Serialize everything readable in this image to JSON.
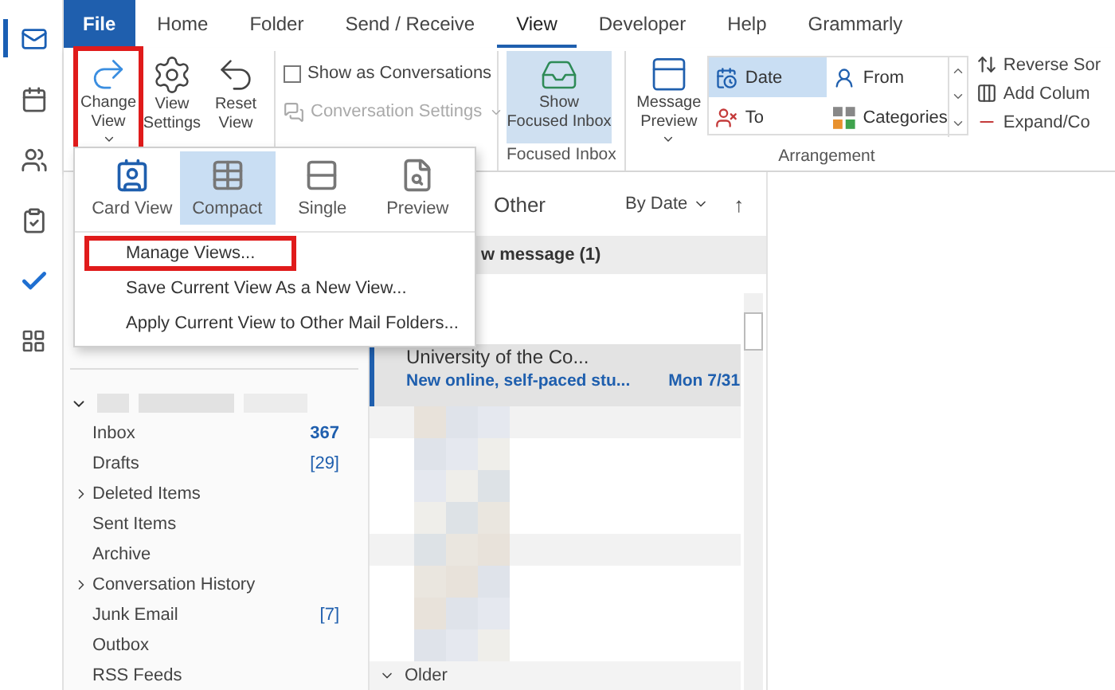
{
  "rail": [
    {
      "kind": "mail",
      "selected": true
    },
    {
      "kind": "calendar",
      "selected": false
    },
    {
      "kind": "people",
      "selected": false
    },
    {
      "kind": "tasks",
      "selected": false
    },
    {
      "kind": "todo",
      "selected": false
    },
    {
      "kind": "apps",
      "selected": false
    }
  ],
  "tabs": [
    {
      "label": "File",
      "kind": "file",
      "selected": false
    },
    {
      "label": "Home",
      "kind": "tab",
      "selected": false
    },
    {
      "label": "Folder",
      "kind": "tab",
      "selected": false
    },
    {
      "label": "Send / Receive",
      "kind": "tab",
      "selected": false
    },
    {
      "label": "View",
      "kind": "tab",
      "selected": true
    },
    {
      "label": "Developer",
      "kind": "tab",
      "selected": false
    },
    {
      "label": "Help",
      "kind": "tab",
      "selected": false
    },
    {
      "label": "Grammarly",
      "kind": "tab",
      "selected": false
    }
  ],
  "ribbon": {
    "view_buttons": [
      {
        "label": "Change View",
        "kind": "change",
        "dropdown": true,
        "highlighted": true
      },
      {
        "label": "View Settings",
        "kind": "settings",
        "dropdown": false,
        "highlighted": false
      },
      {
        "label": "Reset View",
        "kind": "reset",
        "dropdown": false,
        "highlighted": false
      }
    ],
    "show_as_conversations": {
      "label": "Show as Conversations",
      "checked": false
    },
    "conversation_settings": {
      "label": "Conversation Settings",
      "disabled": true
    },
    "focused_inbox": {
      "label": "Show Focused Inbox",
      "selected": true,
      "group": "Focused Inbox"
    },
    "message_preview": {
      "label": "Message Preview"
    },
    "arrangement": {
      "group": "Arrangement",
      "options": [
        {
          "label": "Date",
          "kind": "date",
          "selected": true
        },
        {
          "label": "From",
          "kind": "from",
          "selected": false
        },
        {
          "label": "To",
          "kind": "to",
          "selected": false
        },
        {
          "label": "Categories",
          "kind": "categories",
          "selected": false
        }
      ],
      "commands": [
        {
          "label": "Reverse Sor",
          "kind": "sort"
        },
        {
          "label": "Add Colum",
          "kind": "add"
        },
        {
          "label": "Expand/Co",
          "kind": "expand"
        }
      ]
    }
  },
  "change_view_menu": {
    "views": [
      {
        "label": "Card View",
        "kind": "card",
        "selected": false
      },
      {
        "label": "Compact",
        "kind": "compact",
        "selected": true
      },
      {
        "label": "Single",
        "kind": "single",
        "selected": false
      },
      {
        "label": "Preview",
        "kind": "preview",
        "selected": false
      }
    ],
    "items": [
      {
        "label": "Manage Views...",
        "highlighted": true
      },
      {
        "label": "Save Current View As a New View...",
        "highlighted": false
      },
      {
        "label": "Apply Current View to Other Mail Folders...",
        "highlighted": false
      }
    ]
  },
  "folders": [
    {
      "name": "Inbox",
      "count": "367",
      "count_bold": true,
      "has_children": false
    },
    {
      "name": "Drafts",
      "count": "[29]",
      "count_bold": false,
      "has_children": false
    },
    {
      "name": "Deleted Items",
      "has_children": true
    },
    {
      "name": "Sent Items",
      "has_children": false
    },
    {
      "name": "Archive",
      "has_children": false
    },
    {
      "name": "Conversation History",
      "has_children": true
    },
    {
      "name": "Junk Email",
      "count": "[7]",
      "count_bold": false,
      "has_children": false
    },
    {
      "name": "Outbox",
      "has_children": false
    },
    {
      "name": "RSS Feeds",
      "has_children": false
    }
  ],
  "message_list": {
    "filter": "Other",
    "sort": "By Date",
    "sort_direction": "↑",
    "group_header": "w message (1)",
    "message": {
      "sender": "University of the Co...",
      "subject": "New online, self-paced stu...",
      "date": "Mon 7/31",
      "selected": true
    },
    "older_group": "Older"
  }
}
